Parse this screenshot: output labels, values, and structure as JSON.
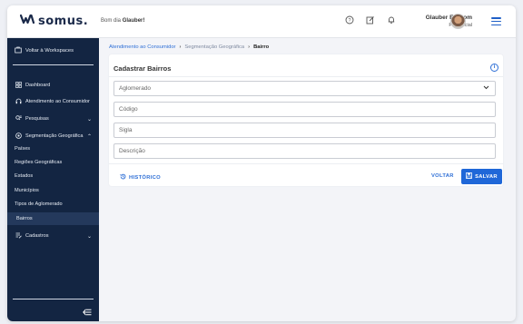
{
  "header": {
    "logo_mark": "ꟽ",
    "logo_text": "somus.",
    "greeting_prefix": "Bom dia",
    "greeting_name": "Glauber!",
    "user_name": "Glauber Elissom",
    "user_role": "Presencial",
    "icons": [
      "help-circle-icon",
      "edit-icon",
      "bell-icon",
      "hamburger-menu-icon"
    ]
  },
  "sidebar": {
    "workspace_label": "Voltar à Workspaces",
    "items": [
      {
        "label": "Dashboard",
        "icon": "dashboard-icon"
      },
      {
        "label": "Atendimento ao Consumidor",
        "icon": "headset-icon"
      },
      {
        "label": "Pesquisas",
        "icon": "search-list-icon",
        "expandable": true
      },
      {
        "label": "Segmentação Geográfica",
        "icon": "location-icon",
        "expanded": true
      }
    ],
    "sub_items": [
      "Países",
      "Regiões Geográficas",
      "Estados",
      "Municípios",
      "Tipos de Aglomerado",
      "Bairros"
    ],
    "active_sub": "Bairros",
    "cadastros_label": "Cadastros"
  },
  "breadcrumb": [
    "Atendimento ao Consumidor",
    "Segmentação Geográfica",
    "Bairro"
  ],
  "form": {
    "title": "Cadastrar Bairros",
    "fields": [
      {
        "placeholder": "Aglomerado",
        "type": "select"
      },
      {
        "placeholder": "Código",
        "type": "text"
      },
      {
        "placeholder": "Sigla",
        "type": "text"
      },
      {
        "placeholder": "Descrição",
        "type": "text"
      }
    ],
    "history_label": "HISTÓRICO",
    "back_label": "VOLTAR",
    "save_label": "SALVAR"
  },
  "colors": {
    "sidebar_bg": "#132542",
    "accent": "#1f67d8",
    "link": "#2e6fd6"
  }
}
